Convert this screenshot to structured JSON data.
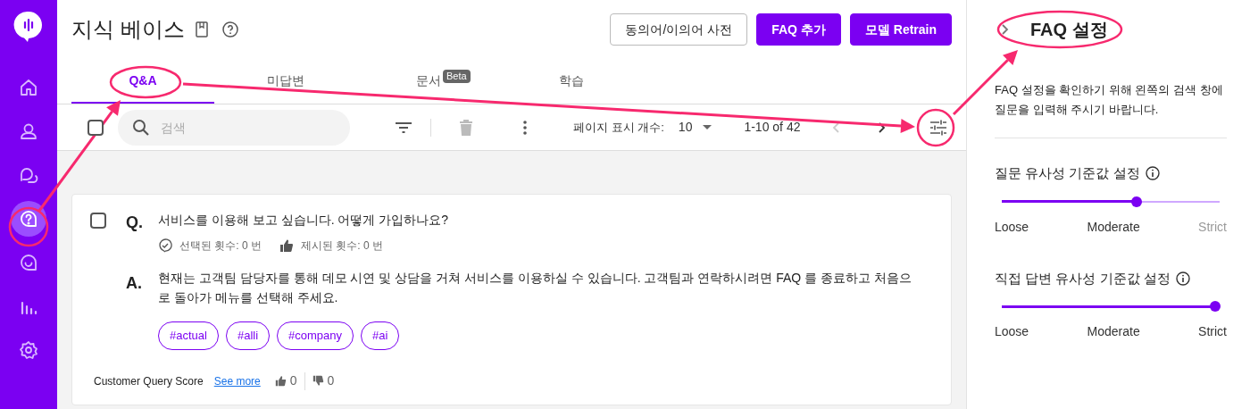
{
  "sidebar": {
    "items": [
      {
        "kind": "home",
        "selected": false
      },
      {
        "kind": "person",
        "selected": false
      },
      {
        "kind": "chats",
        "selected": false
      },
      {
        "kind": "help",
        "selected": true
      },
      {
        "kind": "chat",
        "selected": false
      },
      {
        "kind": "chart",
        "selected": false
      },
      {
        "kind": "settings",
        "selected": false
      }
    ]
  },
  "header": {
    "title": "지식 베이스",
    "buttons": [
      {
        "label": "동의어/이의어 사전",
        "kind": "outline"
      },
      {
        "label": "FAQ 추가",
        "kind": "primary"
      },
      {
        "label": "모델 Retrain",
        "kind": "primary"
      }
    ]
  },
  "tabs": [
    {
      "label": "Q&A",
      "selected": true
    },
    {
      "label": "미답변",
      "selected": false
    },
    {
      "label": "문서",
      "badge": "Beta",
      "selected": false
    },
    {
      "label": "학습",
      "selected": false
    }
  ],
  "toolbar": {
    "select_all_checked": false,
    "search": {
      "placeholder": "검색"
    },
    "page_size_label": "페이지 표시 개수:",
    "page_size": "10",
    "range": "1-10 of 42"
  },
  "faq_items": [
    {
      "checked": false,
      "q_mark": "Q.",
      "question": "서비스를 이용해 보고 싶습니다. 어떻게 가입하나요?",
      "selected_count": "선택된 횟수: 0 번",
      "suggested_count": "제시된 횟수: 0 번",
      "a_mark": "A.",
      "answer": "현재는 고객팀 담당자를 통해 데모 시연 및 상담을 거쳐 서비스를 이용하실 수 있습니다. 고객팀과 연락하시려면 FAQ 를 종료하고 처음으로 돌아가 메뉴를 선택해 주세요.",
      "tags": [
        "#actual",
        "#alli",
        "#company",
        "#ai"
      ],
      "score_label": "Customer Query Score",
      "see_more": "See more",
      "likes": "0",
      "dislikes": "0"
    }
  ],
  "settings_panel": {
    "title": "FAQ 설정",
    "description": "FAQ 설정을 확인하기 위해 왼쪽의 검색 창에 질문을 입력해 주시기 바랍니다.",
    "sliders": [
      {
        "label": "질문 유사성 기준값 설정",
        "level": 0.62,
        "marks": [
          "Loose",
          "Moderate",
          "Strict"
        ]
      },
      {
        "label": "직접 답변 유사성 기준값 설정",
        "level": 0.98,
        "marks": [
          "Loose",
          "Moderate",
          "Strict"
        ]
      }
    ]
  }
}
